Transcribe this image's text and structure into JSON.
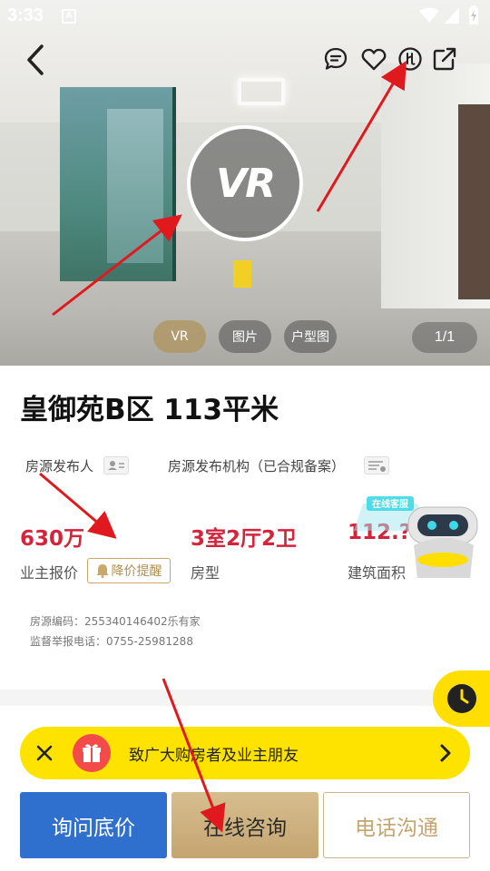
{
  "status_bar": {
    "time": "3:33",
    "notice": "A"
  },
  "hero": {
    "vr_badge": "VR",
    "media_tabs": [
      {
        "label": "VR",
        "active": true
      },
      {
        "label": "图片",
        "active": false
      },
      {
        "label": "户型图",
        "active": false
      }
    ],
    "counter": "1/1",
    "icons": [
      "back-icon",
      "message-icon",
      "heart-icon",
      "compare-icon",
      "share-icon"
    ]
  },
  "listing": {
    "title": "皇御苑B区 113平米",
    "publisher_label": "房源发布人",
    "agency_label": "房源发布机构（已合规备案）",
    "stats": [
      {
        "value": "630万",
        "label": "业主报价"
      },
      {
        "value": "3室2厅2卫",
        "label": "房型"
      },
      {
        "value": "112.??",
        "label": "建筑面积"
      }
    ],
    "price_alert": "降价提醒",
    "code_line": "房源编码：255340146402乐有家",
    "report_line": "监督举报电话：0755-25981288"
  },
  "assistant": {
    "label": "在线客服"
  },
  "banner": {
    "text": "致广大购房者及业主朋友"
  },
  "actions": {
    "ask_price": "询问底价",
    "online_consult": "在线咨询",
    "phone": "电话沟通"
  },
  "colors": {
    "price_red": "#d4243c",
    "brand_blue": "#2f6fcd",
    "gold": "#c4a571",
    "banner_yellow": "#fee300"
  }
}
